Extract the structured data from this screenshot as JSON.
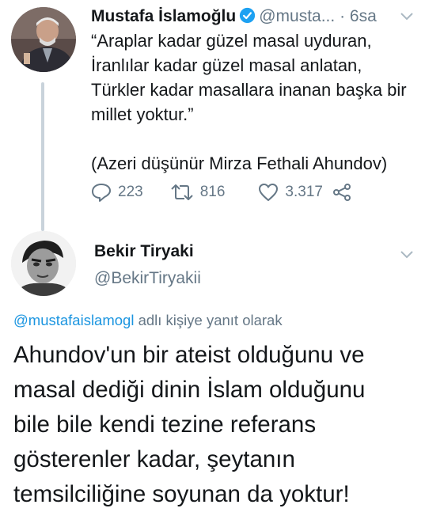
{
  "tweet1": {
    "author_name": "Mustafa İslamoğlu",
    "handle": "@musta...",
    "separator": "·",
    "time": "6sa",
    "lines": [
      "“Araplar kadar güzel masal uyduran,",
      "İranlılar kadar güzel masal anlatan,",
      "Türkler kadar masallara inanan başka bir",
      "millet yoktur.”",
      "(Azeri düşünür Mirza Fethali Ahundov)"
    ],
    "replies": "223",
    "retweets": "816",
    "likes": "3.317"
  },
  "tweet2": {
    "author_name": "Bekir Tiryaki",
    "handle": "@BekirTiryakii",
    "reply_to_mention": "@mustafaislamogl",
    "reply_to_suffix": " adlı kişiye yanıt olarak",
    "lines": [
      "Ahundov'un bir ateist olduğunu ve",
      "masal dediği dinin İslam olduğunu",
      "bile bile kendi tezine referans",
      "gösterenler kadar, şeytanın",
      "temsilciliğine soyunan da yoktur!"
    ]
  },
  "icons": {
    "verified": "verified-badge-icon",
    "reply": "reply-icon",
    "retweet": "retweet-icon",
    "like": "heart-icon",
    "share": "share-icon",
    "more": "chevron-down-icon"
  },
  "colors": {
    "link": "#1b95e0",
    "secondary_text": "#657786",
    "thread_line": "#c9d3db"
  }
}
